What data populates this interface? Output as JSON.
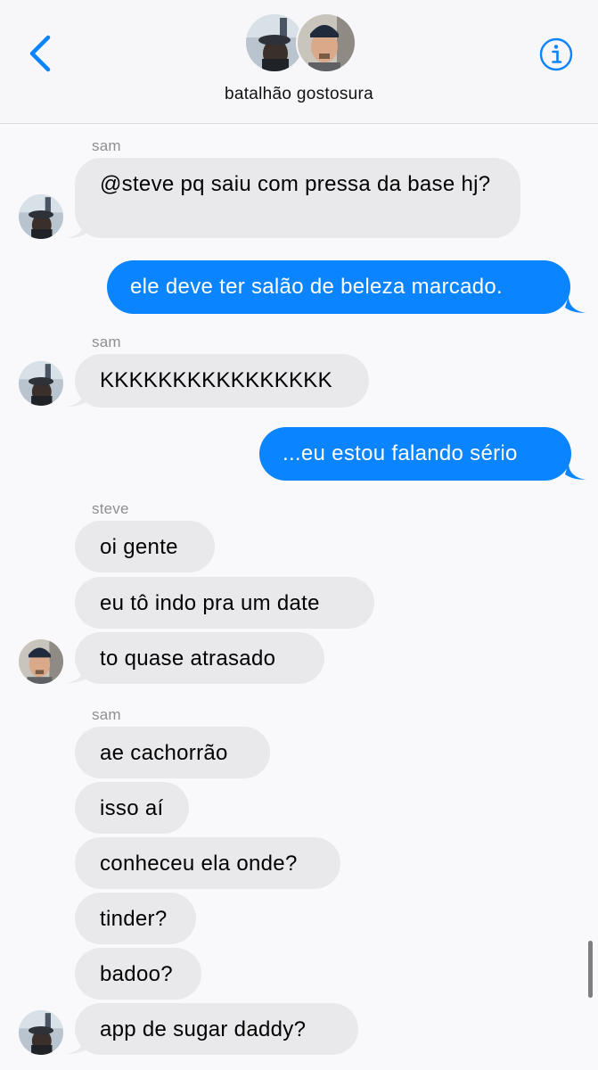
{
  "header": {
    "group_name": "batalhão gostosura",
    "back_icon": "chevron-left-icon",
    "info_icon": "info-circle-icon",
    "accent_color": "#0a84ff"
  },
  "participants": {
    "sam": "sam",
    "steve": "steve"
  },
  "messages": [
    {
      "sender": "sam",
      "direction": "incoming",
      "text": "@steve pq saiu com pressa da base hj?"
    },
    {
      "sender": "me",
      "direction": "outgoing",
      "text": "ele deve ter salão de beleza marcado."
    },
    {
      "sender": "sam",
      "direction": "incoming",
      "text": "KKKKKKKKKKKKKKKK"
    },
    {
      "sender": "me",
      "direction": "outgoing",
      "text": "...eu estou falando sério"
    },
    {
      "sender": "steve",
      "direction": "incoming",
      "text": "oi gente"
    },
    {
      "sender": "steve",
      "direction": "incoming",
      "text": "eu tô indo pra um date"
    },
    {
      "sender": "steve",
      "direction": "incoming",
      "text": "to quase atrasado"
    },
    {
      "sender": "sam",
      "direction": "incoming",
      "text": "ae cachorrão"
    },
    {
      "sender": "sam",
      "direction": "incoming",
      "text": "isso aí"
    },
    {
      "sender": "sam",
      "direction": "incoming",
      "text": "conheceu ela onde?"
    },
    {
      "sender": "sam",
      "direction": "incoming",
      "text": "tinder?"
    },
    {
      "sender": "sam",
      "direction": "incoming",
      "text": "badoo?"
    },
    {
      "sender": "sam",
      "direction": "incoming",
      "text": "app de sugar daddy?"
    }
  ]
}
